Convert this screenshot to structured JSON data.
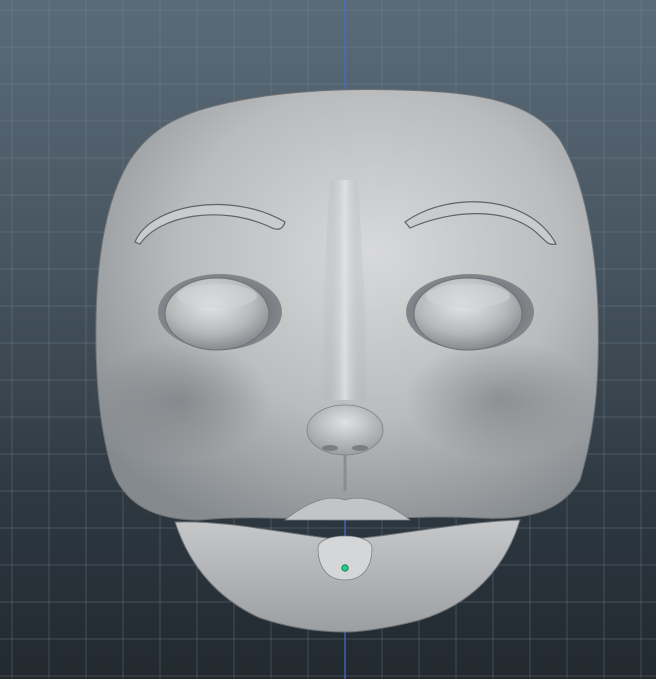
{
  "viewport": {
    "colors": {
      "background_top": "#5a6b78",
      "background_bottom": "#22292f",
      "grid_line": "#7a8c99",
      "axis_line": "#3d6fd6",
      "mesh_base": "#b9bbbd",
      "mesh_highlight": "#d8d9da",
      "mesh_shadow": "#6e7276",
      "selected_vertex": "#1fd18a"
    },
    "grid": {
      "visible": true
    },
    "objects": [
      {
        "name": "face-mesh",
        "type": "sculpt-mesh"
      },
      {
        "name": "eye-left",
        "type": "sphere"
      },
      {
        "name": "eye-right",
        "type": "sphere"
      },
      {
        "name": "jaw-mesh",
        "type": "sculpt-mesh"
      }
    ]
  }
}
